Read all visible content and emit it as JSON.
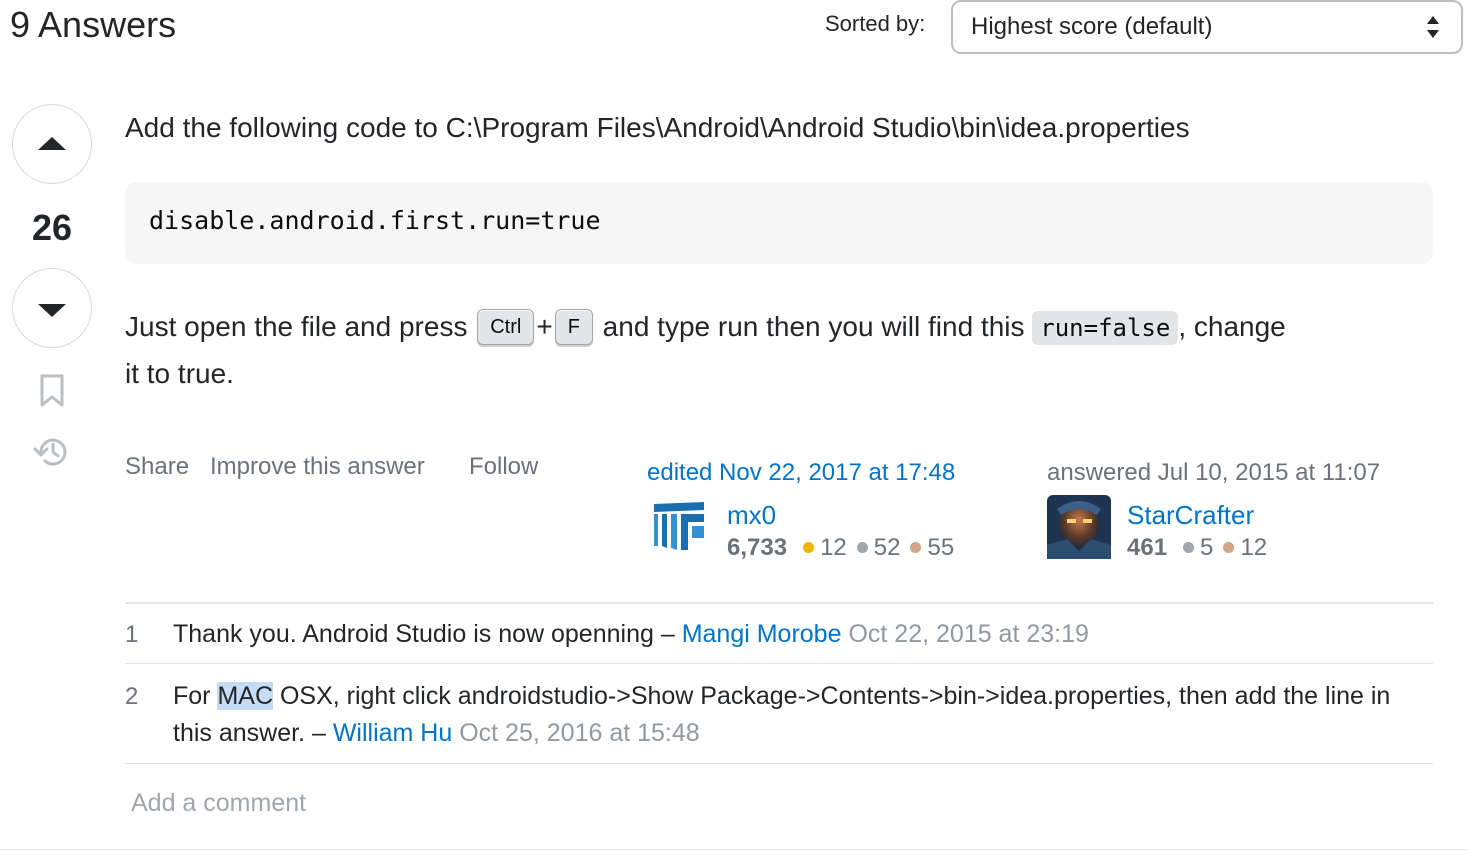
{
  "header": {
    "answers_count": "9 Answers",
    "sorted_label": "Sorted by:",
    "sort_value": "Highest score (default)"
  },
  "answer": {
    "score": "26",
    "line1": "Add the following code to C:\\Program Files\\Android\\Android Studio\\bin\\idea.properties",
    "code": "disable.android.first.run=true",
    "line2_part1": "Just open the file and press ",
    "kbd1": "Ctrl",
    "plus": "+",
    "kbd2": "F",
    "line2_part2": " and type run then you will find this ",
    "inline_code": "run=false",
    "line2_part3": ", change",
    "line3": "it to true."
  },
  "menu": {
    "share": "Share",
    "improve": "Improve this answer",
    "follow": "Follow"
  },
  "editor": {
    "action": "edited Nov 22, 2017 at 17:48",
    "name": "mx0",
    "rep": "6,733",
    "gold": "12",
    "silver": "52",
    "bronze": "55"
  },
  "author": {
    "action": "answered Jul 10, 2015 at 11:07",
    "name": "StarCrafter",
    "rep": "461",
    "silver": "5",
    "bronze": "12"
  },
  "comments": [
    {
      "score": "1",
      "text": "Thank you. Android Studio is now openning – ",
      "user": "Mangi Morobe",
      "date": "Oct 22, 2015 at 23:19"
    },
    {
      "score": "2",
      "text_before": "For ",
      "highlight": "MAC",
      "text_after": " OSX, right click androidstudio->Show Package->Contents->bin->idea.properties, then add the line in this answer. – ",
      "user": "William Hu",
      "date": "Oct 25, 2016 at 15:48"
    }
  ],
  "add_comment": "Add a comment",
  "colors": {
    "link": "#0074cc",
    "muted": "#6a737c",
    "gold": "#f1b600",
    "silver": "#9fa6ad",
    "bronze": "#d1a684",
    "highlight": "#c5dcf5"
  }
}
